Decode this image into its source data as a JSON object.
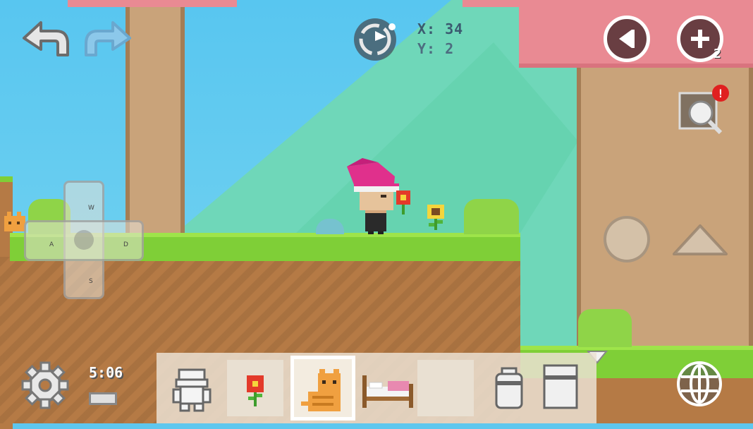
{
  "hud": {
    "coord_x": "X: 34",
    "coord_y": "Y: 2",
    "zoom_level_badge": "2",
    "notification_badge": "!",
    "clock": "5:06"
  },
  "dpad": {
    "up": "W",
    "left": "A",
    "right": "D",
    "down": "S"
  },
  "hotbar": {
    "slots": [
      {
        "item": "character-outfit"
      },
      {
        "item": "red-flower"
      },
      {
        "item": "orange-cat",
        "selected": true
      },
      {
        "item": "pink-bed"
      },
      {
        "item": "empty"
      }
    ],
    "extra_items": [
      "trash-can",
      "storage-box"
    ]
  },
  "colors": {
    "sky": "#5ec7ee",
    "grass": "#7fcf37",
    "dirt": "#b57a45",
    "tree_canopy": "#e98a93",
    "tree_trunk": "#c9a37a",
    "witch_hat": "#e0308c"
  }
}
